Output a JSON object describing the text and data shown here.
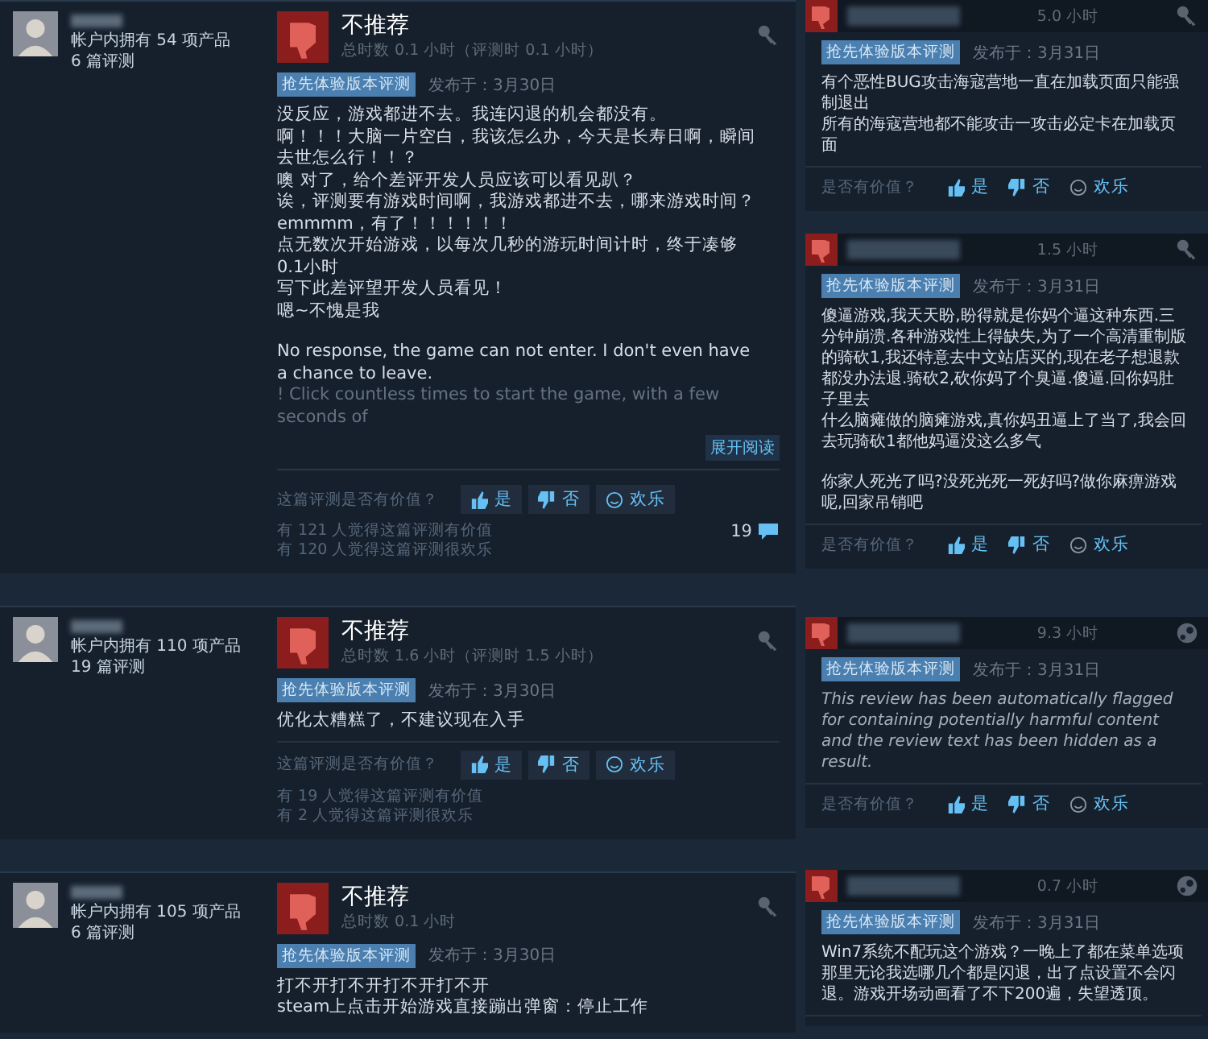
{
  "left_reviews": [
    {
      "owned": "帐户内拥有 54 项产品",
      "review_count": "6 篇评测",
      "recommended": false,
      "verdict": "不推荐",
      "hours": "总时数 0.1 小时（评测时 0.1 小时）",
      "early_access": "抢先体验版本评测",
      "posted": "发布于：3月30日",
      "paragraphs": [
        [
          "没反应，游戏都进不去。我连闪退的机会都没有。",
          "啊！！！大脑一片空白，我该怎么办，今天是长寿日啊，瞬间去世怎么行！！？",
          "噢 对了，给个差评开发人员应该可以看见趴？",
          "诶，评测要有游戏时间啊，我游戏都进不去，哪来游戏时间？",
          "emmmm，有了！！！！！！",
          "点无数次开始游戏，以每次几秒的游玩时间计时，终于凑够0.1小时",
          "写下此差评望开发人员看见！",
          "嗯~不愧是我"
        ],
        [
          "No response, the game can not enter. I don't even have a chance to leave."
        ]
      ],
      "faded_line": "! Click countless times to start the game, with a few seconds of",
      "expand": "展开阅读",
      "helpful_question": "这篇评测是否有价值？",
      "buttons": [
        {
          "kind": "yes",
          "label": "是"
        },
        {
          "kind": "no",
          "label": "否"
        },
        {
          "kind": "funny",
          "label": "欢乐"
        }
      ],
      "stats": [
        "有 121 人觉得这篇评测有价值",
        "有 120 人觉得这篇评测很欢乐"
      ],
      "comments": "19"
    },
    {
      "owned": "帐户内拥有 110 项产品",
      "review_count": "19 篇评测",
      "recommended": false,
      "verdict": "不推荐",
      "hours": "总时数 1.6 小时（评测时 1.5 小时）",
      "early_access": "抢先体验版本评测",
      "posted": "发布于：3月30日",
      "paragraphs": [
        [
          "优化太糟糕了，不建议现在入手"
        ]
      ],
      "helpful_question": "这篇评测是否有价值？",
      "buttons": [
        {
          "kind": "yes",
          "label": "是"
        },
        {
          "kind": "no",
          "label": "否"
        },
        {
          "kind": "funny",
          "label": "欢乐"
        }
      ],
      "stats": [
        "有 19 人觉得这篇评测有价值",
        "有 2 人觉得这篇评测很欢乐"
      ]
    },
    {
      "owned": "帐户内拥有 105 项产品",
      "review_count": "6 篇评测",
      "recommended": false,
      "verdict": "不推荐",
      "hours": "总时数 0.1 小时",
      "early_access": "抢先体验版本评测",
      "posted": "发布于：3月30日",
      "paragraphs": [
        [
          "打不开打不开打不开打不开",
          "steam上点击开始游戏直接蹦出弹窗：停止工作"
        ]
      ]
    }
  ],
  "right_reviews": [
    {
      "recommended": false,
      "hours": "5.0 小时",
      "kind": "key",
      "flagged": false,
      "early_access": "抢先体验版本评测",
      "posted": "发布于：3月31日",
      "paragraphs": [
        [
          "有个恶性BUG攻击海寇营地一直在加载页面只能强制退出",
          "所有的海寇营地都不能攻击一攻击必定卡在加载页面"
        ]
      ],
      "helpful_question": "是否有价值？",
      "buttons": [
        {
          "kind": "yes",
          "label": "是"
        },
        {
          "kind": "no",
          "label": "否"
        },
        {
          "kind": "funny",
          "label": "欢乐"
        }
      ]
    },
    {
      "recommended": false,
      "hours": "1.5 小时",
      "kind": "key",
      "flagged": false,
      "early_access": "抢先体验版本评测",
      "posted": "发布于：3月31日",
      "paragraphs": [
        [
          "傻逼游戏,我天天盼,盼得就是你妈个逼这种东西.三分钟崩溃.各种游戏性上得缺失,为了一个高清重制版的骑砍1,我还特意去中文站店买的,现在老子想退款都没办法退.骑砍2,砍你妈了个臭逼.傻逼.回你妈肚子里去",
          "什么脑瘫做的脑瘫游戏,真你妈丑逼上了当了,我会回去玩骑砍1都他妈逼没这么多气"
        ],
        [
          "你家人死光了吗?没死光死一死好吗?做你麻痹游戏呢,回家吊销吧"
        ]
      ],
      "helpful_question": "是否有价值？",
      "buttons": [
        {
          "kind": "yes",
          "label": "是"
        },
        {
          "kind": "no",
          "label": "否"
        },
        {
          "kind": "funny",
          "label": "欢乐"
        }
      ]
    },
    {
      "recommended": false,
      "hours": "9.3 小时",
      "kind": "steam",
      "flagged": true,
      "early_access": "抢先体验版本评测",
      "posted": "发布于：3月31日",
      "paragraphs": [
        [
          "This review has been automatically flagged for containing potentially harmful content and the review text has been hidden as a result."
        ]
      ],
      "helpful_question": "是否有价值？",
      "buttons": [
        {
          "kind": "yes",
          "label": "是"
        },
        {
          "kind": "no",
          "label": "否"
        },
        {
          "kind": "funny",
          "label": "欢乐"
        }
      ]
    },
    {
      "recommended": false,
      "hours": "0.7 小时",
      "kind": "steam",
      "flagged": false,
      "early_access": "抢先体验版本评测",
      "posted": "发布于：3月31日",
      "paragraphs": [
        [
          "Win7系统不配玩这个游戏？一晚上了都在菜单选项那里无论我选哪几个都是闪退，出了点设置不会闪退。游戏开场动画看了不下200遍，失望透顶。"
        ]
      ]
    }
  ]
}
